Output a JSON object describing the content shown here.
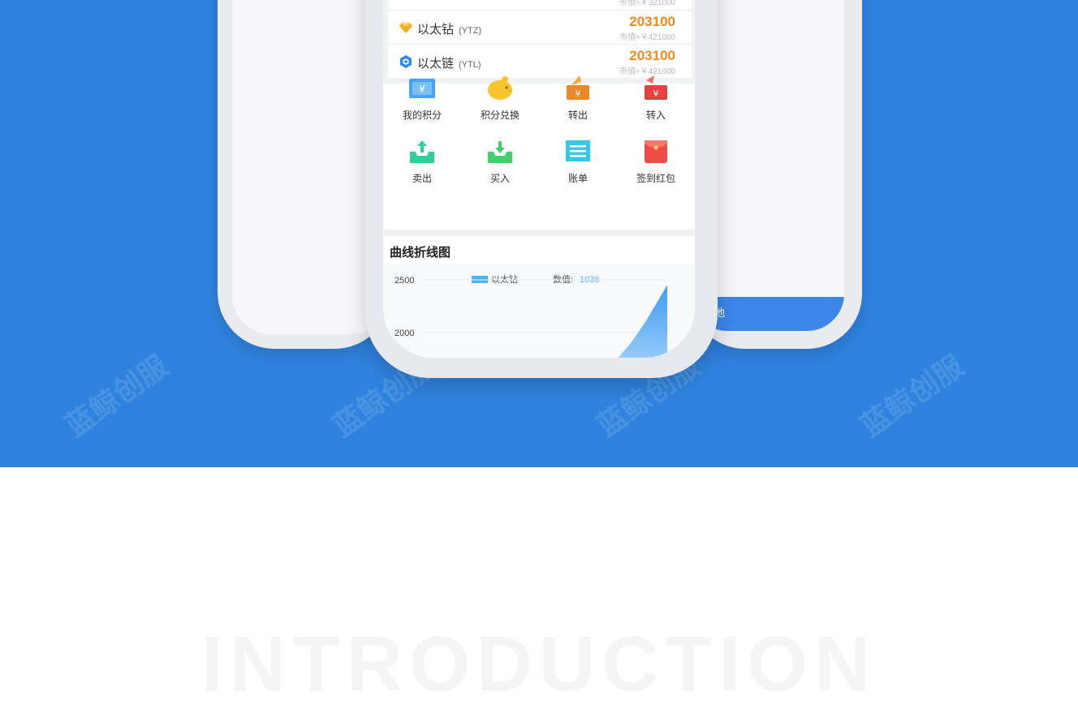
{
  "coins": [
    {
      "name": "以太钻",
      "code": "(YTZ)",
      "value": "203100",
      "market": "市值≈￥421000",
      "icon": "diamond-icon"
    },
    {
      "name": "以太链",
      "code": "(YTL)",
      "value": "203100",
      "market": "市值≈￥421000",
      "icon": "chain-hex-icon"
    }
  ],
  "coin_top_market": "市值≈￥321000",
  "menu": [
    {
      "label": "我的积分",
      "icon": "points-ticket-icon",
      "color": "#4aa3ef"
    },
    {
      "label": "积分兑换",
      "icon": "piggy-bank-icon",
      "color": "#f7c52b"
    },
    {
      "label": "转出",
      "icon": "transfer-out-icon",
      "color": "#f19a26"
    },
    {
      "label": "转入",
      "icon": "transfer-in-icon",
      "color": "#ee4d4d"
    },
    {
      "label": "卖出",
      "icon": "sell-tray-icon",
      "color": "#2fcf9a"
    },
    {
      "label": "买入",
      "icon": "buy-tray-icon",
      "color": "#3fcf6b"
    },
    {
      "label": "账单",
      "icon": "bill-icon",
      "color": "#35c6e8"
    },
    {
      "label": "签到红包",
      "icon": "red-envelope-icon",
      "color": "#ef4b47"
    }
  ],
  "chart_card": {
    "title": "曲线折线图"
  },
  "chart_data": {
    "type": "area",
    "legend": [
      {
        "name": "以太钻",
        "color": "#4fb3f6"
      }
    ],
    "readout_label": "数值:",
    "readout_value": "1036",
    "yticks": [
      "2500",
      "2000"
    ],
    "ylim": [
      1500,
      2500
    ],
    "series": [
      {
        "name": "以太钻",
        "x": [
          0,
          0.55,
          0.7,
          0.82,
          1.0
        ],
        "y": [
          1500,
          1700,
          1900,
          2100,
          2450
        ]
      }
    ]
  },
  "right_phone_bar_text": "他",
  "watermark": "蓝鲸创服",
  "intro_text": "INTRODUCTION"
}
